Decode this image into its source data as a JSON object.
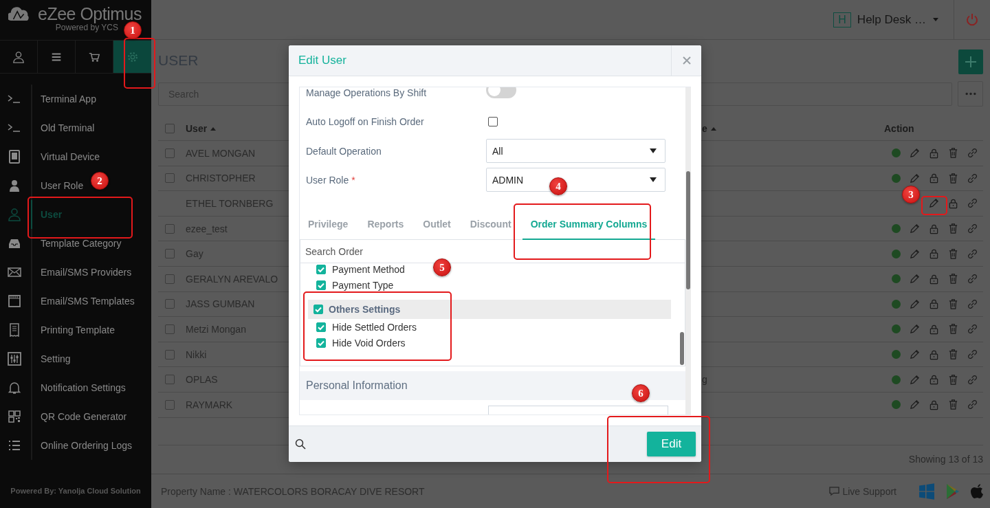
{
  "brand": {
    "name": "eZee Optimus",
    "tagline": "Powered by YCS"
  },
  "nav_tabs": [
    {
      "selected": false
    },
    {
      "selected": false
    },
    {
      "selected": false
    },
    {
      "selected": true
    }
  ],
  "sidebar": {
    "items": [
      {
        "label": "Terminal App",
        "selected": false
      },
      {
        "label": "Old Terminal",
        "selected": false
      },
      {
        "label": "Virtual Device",
        "selected": false
      },
      {
        "label": "User Role",
        "selected": false
      },
      {
        "label": "User",
        "selected": true
      },
      {
        "label": "Template Category",
        "selected": false
      },
      {
        "label": "Email/SMS Providers",
        "selected": false
      },
      {
        "label": "Email/SMS Templates",
        "selected": false
      },
      {
        "label": "Printing Template",
        "selected": false
      },
      {
        "label": "Setting",
        "selected": false
      },
      {
        "label": "Notification Settings",
        "selected": false
      },
      {
        "label": "QR Code Generator",
        "selected": false
      },
      {
        "label": "Online Ordering Logs",
        "selected": false
      }
    ],
    "footer": "Powered By: Yanolja Cloud Solution"
  },
  "top_bar": {
    "badge": "H",
    "account": "Help Desk …"
  },
  "page": {
    "title": "USER",
    "search": {
      "placeholder": "Search"
    }
  },
  "table": {
    "columns": [
      {
        "label": "User",
        "sorted": true
      },
      {
        "label": "e",
        "sorted": true
      },
      {
        "label": "Action",
        "sorted": false
      }
    ],
    "select_all": {
      "checked": false
    },
    "rows": [
      {
        "user": "AVEL MONGAN",
        "checked": false,
        "active": true,
        "deletable": true
      },
      {
        "user": "CHRISTOPHER",
        "checked": false,
        "active": true,
        "deletable": true
      },
      {
        "user": "ETHEL TORNBERG",
        "active": false,
        "deletable": false
      },
      {
        "user": "ezee_test",
        "checked": false,
        "active": true,
        "deletable": true
      },
      {
        "user": "Gay",
        "checked": false,
        "active": true,
        "deletable": true
      },
      {
        "user": "GERALYN AREVALO",
        "checked": false,
        "active": true,
        "deletable": true
      },
      {
        "user": "JASS GUMBAN",
        "checked": false,
        "active": true,
        "deletable": true
      },
      {
        "user": "Metzi Mongan",
        "checked": false,
        "active": true,
        "deletable": true
      },
      {
        "user": "Nikki",
        "checked": false,
        "active": true,
        "deletable": true
      },
      {
        "user": "OPLAS",
        "column_2": "g",
        "checked": false,
        "active": true,
        "deletable": true
      },
      {
        "user": "RAYMARK",
        "checked": false,
        "active": true,
        "deletable": true
      }
    ]
  },
  "status": "Showing 13 of 13",
  "footer": {
    "property": "Property Name : WATERCOLORS BORACAY DIVE RESORT",
    "live_support": "Live Support"
  },
  "modal": {
    "title": "Edit User",
    "fields": [
      {
        "kind": "toggle",
        "label": "Manage Operations By Shift",
        "on": false
      },
      {
        "kind": "checkbox",
        "label": "Auto Logoff on Finish Order",
        "checked": false
      },
      {
        "kind": "select",
        "label": "Default Operation",
        "value": "All"
      },
      {
        "kind": "select",
        "label": "User Role",
        "required_mark": "*",
        "value": "ADMIN"
      }
    ],
    "tabs": [
      {
        "label": "Privilege",
        "selected": false
      },
      {
        "label": "Reports",
        "selected": false
      },
      {
        "label": "Outlet",
        "selected": false
      },
      {
        "label": "Discount",
        "selected": false
      },
      {
        "label": "Order Summary Columns",
        "selected": true
      }
    ],
    "search": {
      "placeholder": "Search Order"
    },
    "options": [
      {
        "kind": "item",
        "label": "Payment Method",
        "checked": true
      },
      {
        "kind": "item",
        "label": "Payment Type",
        "checked": true
      },
      {
        "kind": "group",
        "label": "Others Settings",
        "checked": true,
        "children": [
          {
            "label": "Hide Settled Orders",
            "checked": true
          },
          {
            "label": "Hide Void Orders",
            "checked": true
          }
        ]
      }
    ],
    "section": "Personal Information",
    "button": "Edit"
  },
  "annotations": [
    {
      "label": "1"
    },
    {
      "label": "2"
    },
    {
      "label": "3"
    },
    {
      "label": "4"
    },
    {
      "label": "5"
    },
    {
      "label": "6"
    }
  ]
}
